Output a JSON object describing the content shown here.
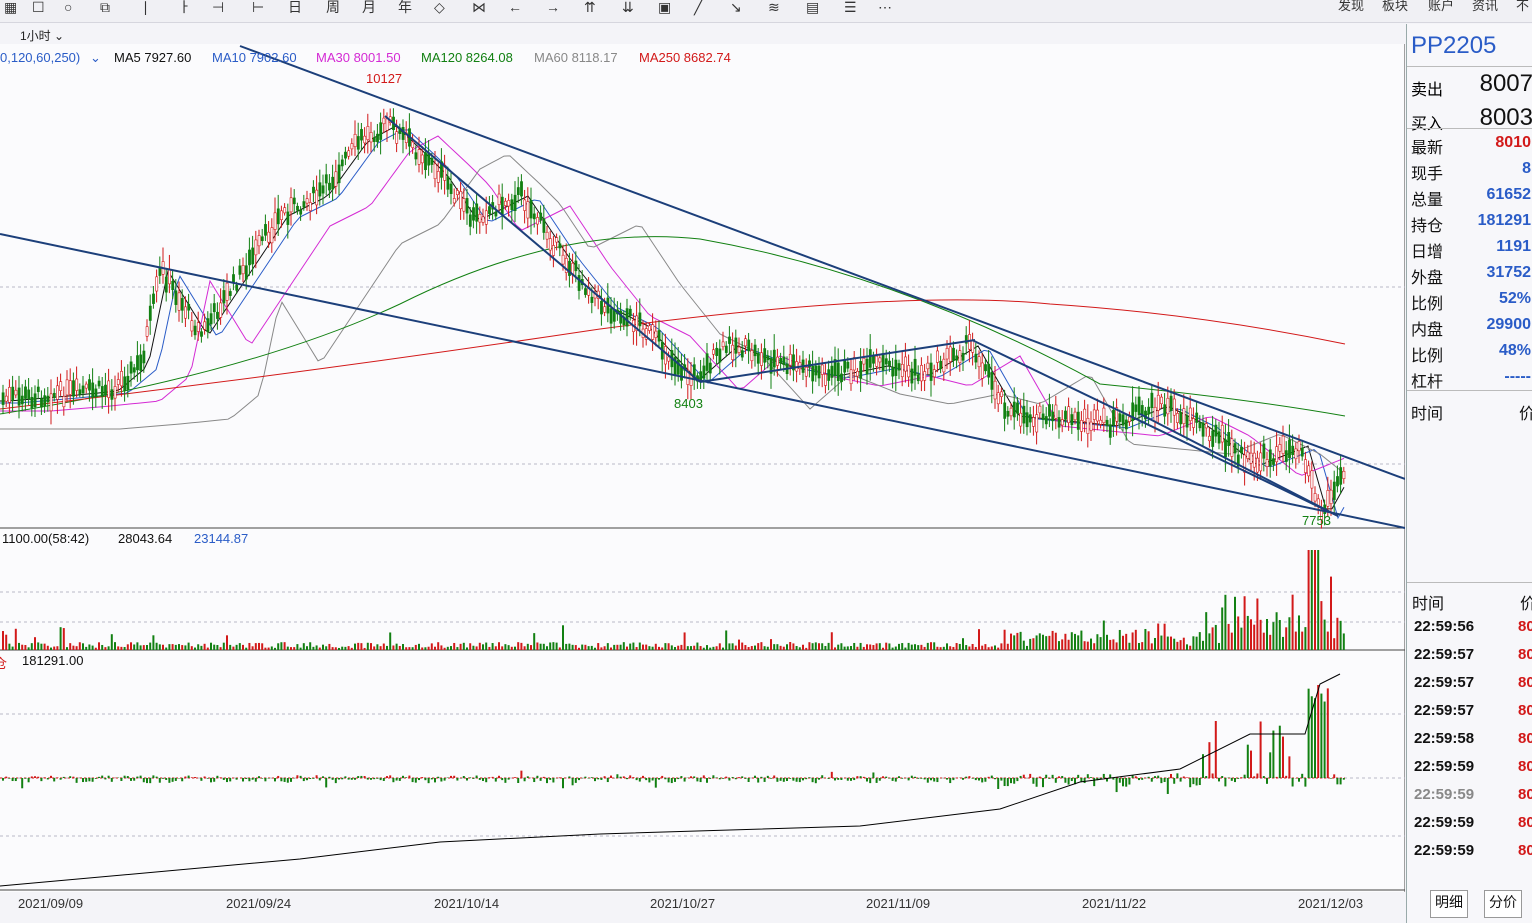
{
  "toolbar": {
    "icons": [
      "grid-icon",
      "square-icon",
      "circle-icon",
      "link-icon",
      "period-1min-icon",
      "period-5min-icon",
      "period-30min-icon",
      "period-60min-icon",
      "period-day-icon",
      "period-week-icon",
      "period-month-icon",
      "period-year-icon",
      "zoom-in-icon",
      "zoom-out-icon",
      "back-icon",
      "forward-icon",
      "up-icon",
      "down-icon",
      "window-icon",
      "line-draw-icon",
      "arrow-draw-icon",
      "multi-line-icon",
      "table-icon",
      "doc-icon",
      "more-icon"
    ],
    "glyphs": [
      "▦",
      "☐",
      "○",
      "⧉",
      "∣",
      "ㅏ",
      "⊣",
      "⊢",
      "日",
      "周",
      "月",
      "年",
      "◇",
      "⋈",
      "←",
      "→",
      "⇈",
      "⇊",
      "▣",
      "╱",
      "↘",
      "≋",
      "▤",
      "☰",
      "⋯"
    ],
    "menus": [
      "发现",
      "板块",
      "账户",
      "资讯",
      "不"
    ]
  },
  "period": "1小时",
  "ma_legend": [
    {
      "label": "0,120,60,250)",
      "color": "#2a5cc7"
    },
    {
      "label": "MA5 7927.60",
      "color": "#111111"
    },
    {
      "label": "MA10 7902.60",
      "color": "#2a5cc7"
    },
    {
      "label": "MA30 8001.50",
      "color": "#d42ad4"
    },
    {
      "label": "MA120 8264.08",
      "color": "#128012"
    },
    {
      "label": "MA60 8118.17",
      "color": "#888888"
    },
    {
      "label": "MA250 8682.74",
      "color": "#d21919"
    }
  ],
  "annotations": {
    "high": "10127",
    "mid_low": "8403",
    "low": "7753"
  },
  "volume_legend": {
    "label": "1100.00(58:42)",
    "v1": "28043.64",
    "v2": "23144.87"
  },
  "oi_legend": {
    "prefix": "仓",
    "value": "181291.00"
  },
  "dates": [
    "2021/09/09",
    "2021/09/24",
    "2021/10/14",
    "2021/10/27",
    "2021/11/09",
    "2021/11/22",
    "2021/12/03"
  ],
  "quote": {
    "symbol": "PP2205",
    "ask_label": "卖出",
    "ask": "8007",
    "bid_label": "买入",
    "bid": "8003",
    "rows": [
      {
        "label": "最新",
        "value": "8010",
        "color": "#d21919"
      },
      {
        "label": "现手",
        "value": "8",
        "color": "#2a5cc7"
      },
      {
        "label": "总量",
        "value": "61652",
        "color": "#2a5cc7"
      },
      {
        "label": "持仓",
        "value": "181291",
        "color": "#2a5cc7"
      },
      {
        "label": "日增",
        "value": "1191",
        "color": "#2a5cc7"
      },
      {
        "label": "外盘",
        "value": "31752",
        "color": "#2a5cc7"
      },
      {
        "label": "比例",
        "value": "52%",
        "color": "#2a5cc7"
      },
      {
        "label": "内盘",
        "value": "29900",
        "color": "#2a5cc7"
      },
      {
        "label": "比例",
        "value": "48%",
        "color": "#2a5cc7"
      },
      {
        "label": "杠杆",
        "value": "-----",
        "color": "#2a5cc7"
      }
    ],
    "col_time": "时间",
    "col_price": "价"
  },
  "ticks_header": {
    "time": "时间",
    "price": "价"
  },
  "ticks": [
    {
      "time": "22:59:56",
      "price": "80"
    },
    {
      "time": "22:59:57",
      "price": "80"
    },
    {
      "time": "22:59:57",
      "price": "80"
    },
    {
      "time": "22:59:57",
      "price": "80"
    },
    {
      "time": "22:59:58",
      "price": "80"
    },
    {
      "time": "22:59:59",
      "price": "80"
    },
    {
      "time": "22:59:59",
      "price": "80"
    },
    {
      "time": "22:59:59",
      "price": "80"
    },
    {
      "time": "22:59:59",
      "price": "80"
    }
  ],
  "tabs": [
    "明细",
    "分价"
  ],
  "colors": {
    "up": "#d21919",
    "down": "#128012",
    "trendline": "#1c3f7a",
    "bg": "#fbfbfd"
  }
}
